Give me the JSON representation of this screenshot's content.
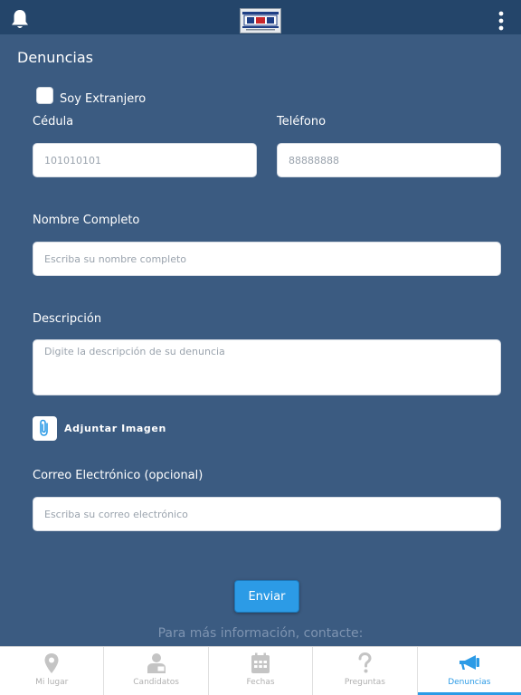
{
  "header": {
    "bell_icon": "bell-icon",
    "logo": "tse-logo",
    "menu_icon": "more-vertical-icon"
  },
  "page": {
    "title": "Denuncias"
  },
  "form": {
    "foreigner_label": "Soy Extranjero",
    "foreigner_checked": false,
    "cedula": {
      "label": "Cédula",
      "placeholder": "101010101"
    },
    "telefono": {
      "label": "Teléfono",
      "placeholder": "88888888"
    },
    "nombre": {
      "label": "Nombre Completo",
      "placeholder": "Escriba su nombre completo"
    },
    "descripcion": {
      "label": "Descripción",
      "placeholder": "Digite la descripción de su denuncia"
    },
    "attach_label": "Adjuntar Imagen",
    "correo": {
      "label": "Correo Electrónico (opcional)",
      "placeholder": "Escriba su correo electrónico"
    },
    "submit_label": "Enviar"
  },
  "footer_text": "Para más información, contacte:",
  "tabs": [
    {
      "label": "Mi lugar",
      "icon": "location-pin-icon",
      "active": false
    },
    {
      "label": "Candidatos",
      "icon": "person-card-icon",
      "active": false
    },
    {
      "label": "Fechas",
      "icon": "calendar-icon",
      "active": false
    },
    {
      "label": "Preguntas",
      "icon": "question-icon",
      "active": false
    },
    {
      "label": "Denuncias",
      "icon": "megaphone-icon",
      "active": true
    }
  ],
  "colors": {
    "background": "#3b5b81",
    "topbar": "#24456a",
    "accent": "#2c9be6"
  }
}
